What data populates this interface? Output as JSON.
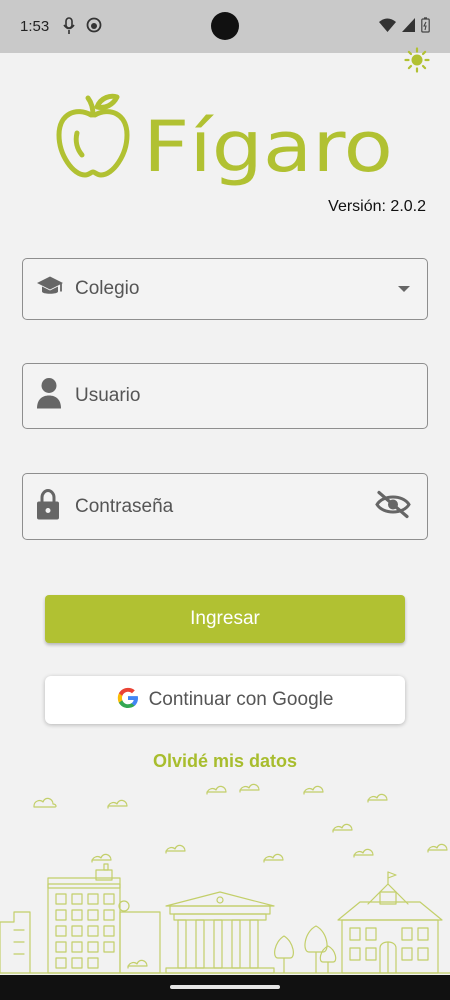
{
  "status_bar": {
    "time": "1:53",
    "icons": [
      "mic-notification-icon",
      "android-notification-icon",
      "wifi-icon",
      "signal-icon",
      "battery-icon"
    ]
  },
  "theme_toggle": {
    "icon": "sun-icon"
  },
  "logo": {
    "text": "Fígaro",
    "icon": "apple-icon"
  },
  "version": "Versión: 2.0.2",
  "form": {
    "colegio": {
      "label": "Colegio",
      "icon": "graduation-cap-icon",
      "trailing_icon": "dropdown-arrow-icon"
    },
    "usuario": {
      "label": "Usuario",
      "icon": "person-icon"
    },
    "password": {
      "label": "Contraseña",
      "icon": "lock-icon",
      "trailing_icon": "visibility-off-icon"
    }
  },
  "buttons": {
    "login": "Ingresar",
    "google": "Continuar con Google"
  },
  "forgot_link": "Olvidé mis datos",
  "colors": {
    "brand_green": "#b1c132",
    "link_green": "#a8bd2e",
    "status_bar": "#c9c9c9",
    "background": "#f2f2f2"
  }
}
